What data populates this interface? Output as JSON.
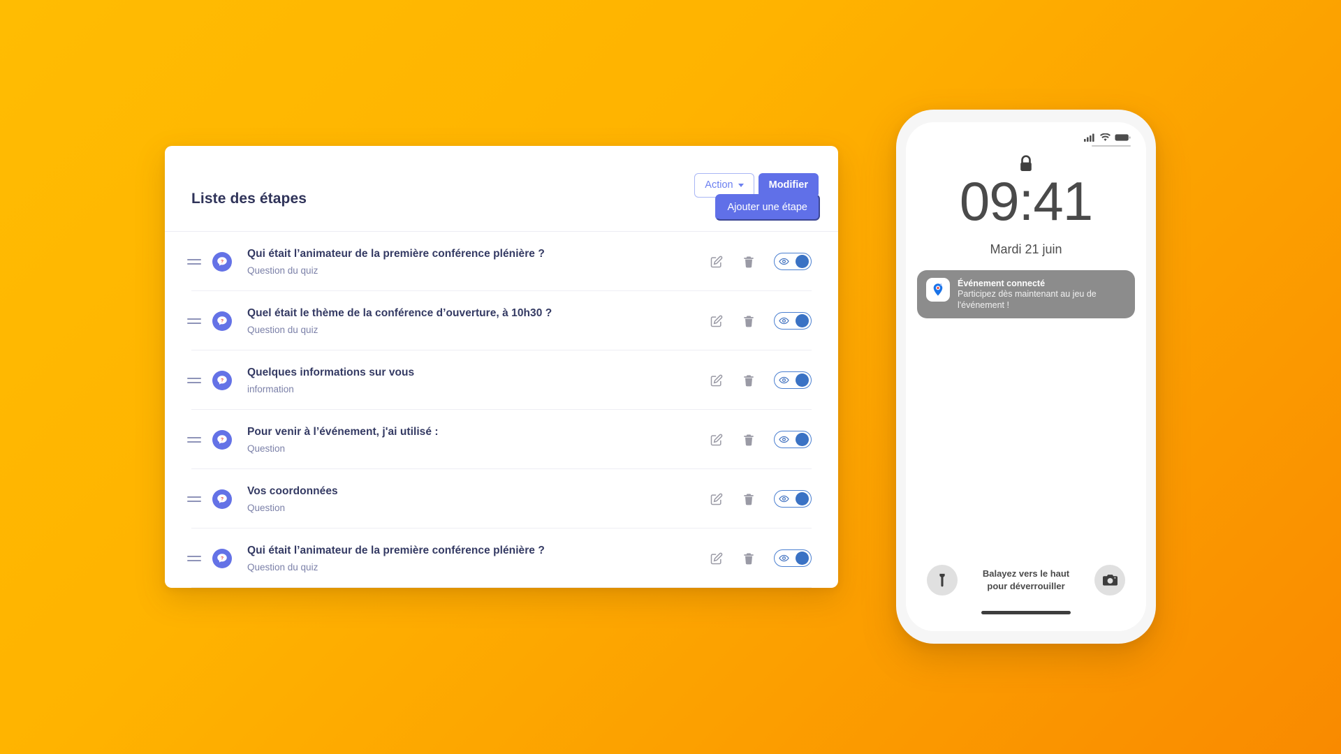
{
  "theme": {
    "bg_gradient_from": "#FFBC02",
    "bg_gradient_to": "#F98A00",
    "accent_blue": "#6070e8",
    "title_color": "#2f3359",
    "toggle_blue": "#3a72c4"
  },
  "card": {
    "title": "Liste des étapes",
    "buttons": {
      "action_label": "Action",
      "modify_label": "Modifier",
      "add_step_label": "Ajouter une étape"
    },
    "row_icons": {
      "drag": "drag-handle-icon",
      "type": "question-bubble-icon",
      "edit": "edit-pencil-icon",
      "delete": "trash-icon",
      "visibility": "eye-toggle-icon"
    },
    "steps": [
      {
        "title": "Qui était l’animateur de la première conférence plénière ?",
        "subtitle": "Question du quiz",
        "visible": true
      },
      {
        "title": "Quel était le thème de la conférence d’ouverture, à 10h30 ?",
        "subtitle": "Question du quiz",
        "visible": true
      },
      {
        "title": "Quelques informations sur vous",
        "subtitle": "information",
        "visible": true
      },
      {
        "title": "Pour venir à l’événement, j'ai utilisé :",
        "subtitle": "Question",
        "visible": true
      },
      {
        "title": "Vos coordonnées",
        "subtitle": "Question",
        "visible": true
      },
      {
        "title": "Qui était l’animateur de la première conférence plénière ?",
        "subtitle": "Question du quiz",
        "visible": true
      }
    ]
  },
  "phone": {
    "status_bar": {
      "signal_icon": "cellular-signal-icon",
      "wifi_icon": "wifi-icon",
      "battery_icon": "battery-icon"
    },
    "lock_icon": "lock-closed-icon",
    "time": "09:41",
    "date": "Mardi 21 juin",
    "notification": {
      "app_icon": "map-pin-app-icon",
      "title": "Événement connecté",
      "text": "Participez dès maintenant au jeu de l'événement !"
    },
    "bottom": {
      "flashlight_icon": "flashlight-icon",
      "camera_icon": "camera-icon",
      "swipe_line1": "Balayez vers le haut",
      "swipe_line2": "pour déverrouiller"
    }
  }
}
